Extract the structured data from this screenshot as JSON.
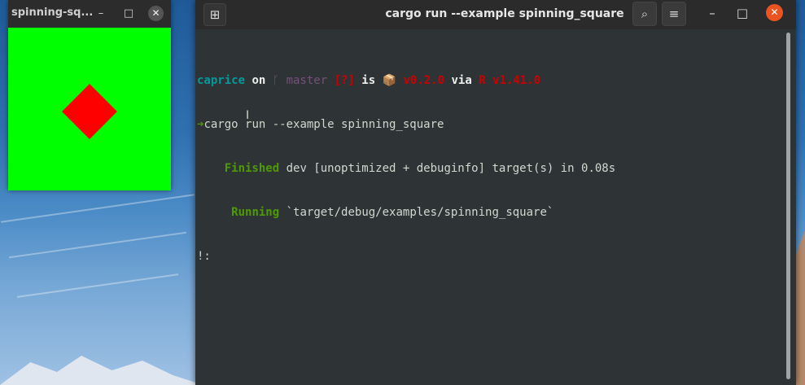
{
  "app_window": {
    "title": "spinning-sq...",
    "min_glyph": "–",
    "max_glyph": "□",
    "close_glyph": "✕",
    "canvas_color": "#00ff00",
    "square_color": "#ff0000"
  },
  "terminal": {
    "title": "cargo run --example spinning_square",
    "new_tab_glyph": "⊞",
    "search_glyph": "⌕",
    "menu_glyph": "≡",
    "min_glyph": "–",
    "max_glyph": "□",
    "close_glyph": "✕",
    "prompt": {
      "dir": "caprice",
      "on": " on ",
      "branch_icon": "ᚴ",
      "branch": " master ",
      "status": "[?]",
      "is": " is ",
      "pkg_icon": "📦",
      "version": " v0.2.0",
      "via": " via ",
      "rust_icon": "R",
      "rust_version": " v1.41.0"
    },
    "command_arrow": "➜",
    "command": "cargo run --example spinning_square",
    "finished_label": "Finished",
    "finished_text": " dev [unoptimized + debuginfo] target(s) in 0.08s",
    "running_label": "Running",
    "running_text": " `target/debug/examples/spinning_square`",
    "last_line": "!:",
    "cursor_glyph": "I"
  }
}
